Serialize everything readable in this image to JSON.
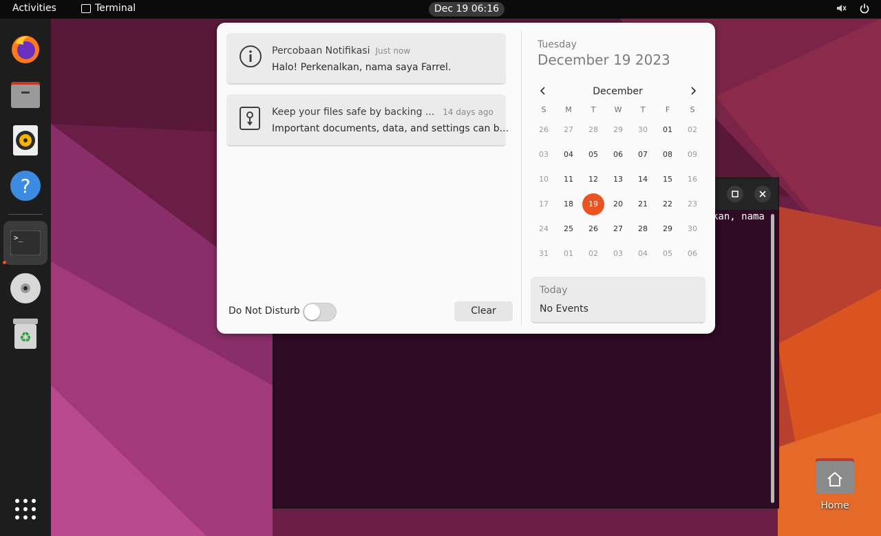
{
  "topbar": {
    "activities": "Activities",
    "app_name": "Terminal",
    "clock": "Dec 19  06:16"
  },
  "dock": {
    "items": [
      "firefox",
      "files",
      "rhythmbox",
      "help",
      "terminal",
      "disc",
      "trash",
      "show-apps"
    ],
    "active": "terminal",
    "accent": "#e95420"
  },
  "terminal": {
    "visible_text": "kan, nama"
  },
  "desktop": {
    "home_label": "Home"
  },
  "notifications": [
    {
      "icon": "info-icon",
      "title": "Percobaan Notifikasi",
      "time": "Just now",
      "body": "Halo! Perkenalkan, nama saya Farrel."
    },
    {
      "icon": "backup-icon",
      "title": "Keep your files safe by backing ...",
      "time": "14 days ago",
      "body": "Important documents, data, and settings can b..."
    }
  ],
  "dnd": {
    "label": "Do Not Disturb",
    "enabled": false
  },
  "clear_label": "Clear",
  "calendar": {
    "weekday": "Tuesday",
    "date": "December 19 2023",
    "month": "December",
    "dow": [
      "S",
      "M",
      "T",
      "W",
      "T",
      "F",
      "S"
    ],
    "weeks": [
      [
        "26",
        "27",
        "28",
        "29",
        "30",
        "01",
        "02"
      ],
      [
        "03",
        "04",
        "05",
        "06",
        "07",
        "08",
        "09"
      ],
      [
        "10",
        "11",
        "12",
        "13",
        "14",
        "15",
        "16"
      ],
      [
        "17",
        "18",
        "19",
        "20",
        "21",
        "22",
        "23"
      ],
      [
        "24",
        "25",
        "26",
        "27",
        "28",
        "29",
        "30"
      ],
      [
        "31",
        "01",
        "02",
        "03",
        "04",
        "05",
        "06"
      ]
    ],
    "today": "19",
    "today_color": "#e95420"
  },
  "events": {
    "title": "Today",
    "body": "No Events"
  }
}
